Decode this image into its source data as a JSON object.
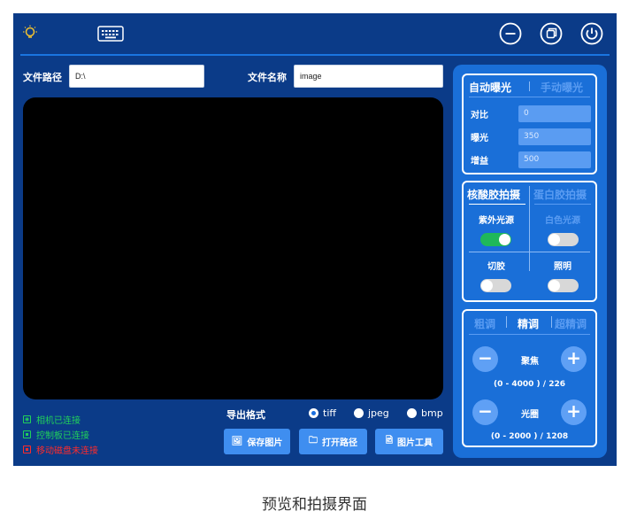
{
  "toolbar": {
    "bulb_icon": "lightbulb-icon",
    "keyboard_icon": "keyboard-icon",
    "window_buttons": [
      "minimize-icon",
      "restore-icon",
      "power-icon"
    ]
  },
  "path": {
    "label": "文件路径",
    "value": "D:\\"
  },
  "filename": {
    "label": "文件名称",
    "value": "image"
  },
  "status": [
    {
      "text": "相机已连接",
      "color": "#21d15a",
      "icon": "camera-icon"
    },
    {
      "text": "控制板已连接",
      "color": "#21d15a",
      "icon": "board-icon"
    },
    {
      "text": "移动磁盘未连接",
      "color": "#ff2b2b",
      "icon": "disk-icon"
    }
  ],
  "export": {
    "label": "导出格式",
    "options": [
      "tiff",
      "jpeg",
      "bmp"
    ],
    "selected": "tiff"
  },
  "buttons": {
    "save": "保存图片",
    "open": "打开路径",
    "tools": "图片工具"
  },
  "exposure": {
    "tab_auto": "自动曝光",
    "tab_manual": "手动曝光",
    "rows": [
      {
        "label": "对比",
        "value": "0"
      },
      {
        "label": "曝光",
        "value": "350"
      },
      {
        "label": "增益",
        "value": "500"
      }
    ]
  },
  "capture": {
    "tab_nucleic": "核酸胶拍摄",
    "tab_protein": "蛋白胶拍摄",
    "uv_label": "紫外光源",
    "white_label": "白色光源",
    "cut_label": "切胶",
    "light_label": "照明",
    "uv_on": true,
    "white_on": false,
    "cut_on": false,
    "light_on": false
  },
  "adjust": {
    "tab_coarse": "粗调",
    "tab_fine": "精调",
    "tab_super": "超精调",
    "focus_label": "聚焦",
    "focus_range": "(0 - 4000 )  /  226",
    "aperture_label": "光圈",
    "aperture_range": "(0 - 2000 )  /  1208"
  },
  "caption": "预览和拍摄界面"
}
